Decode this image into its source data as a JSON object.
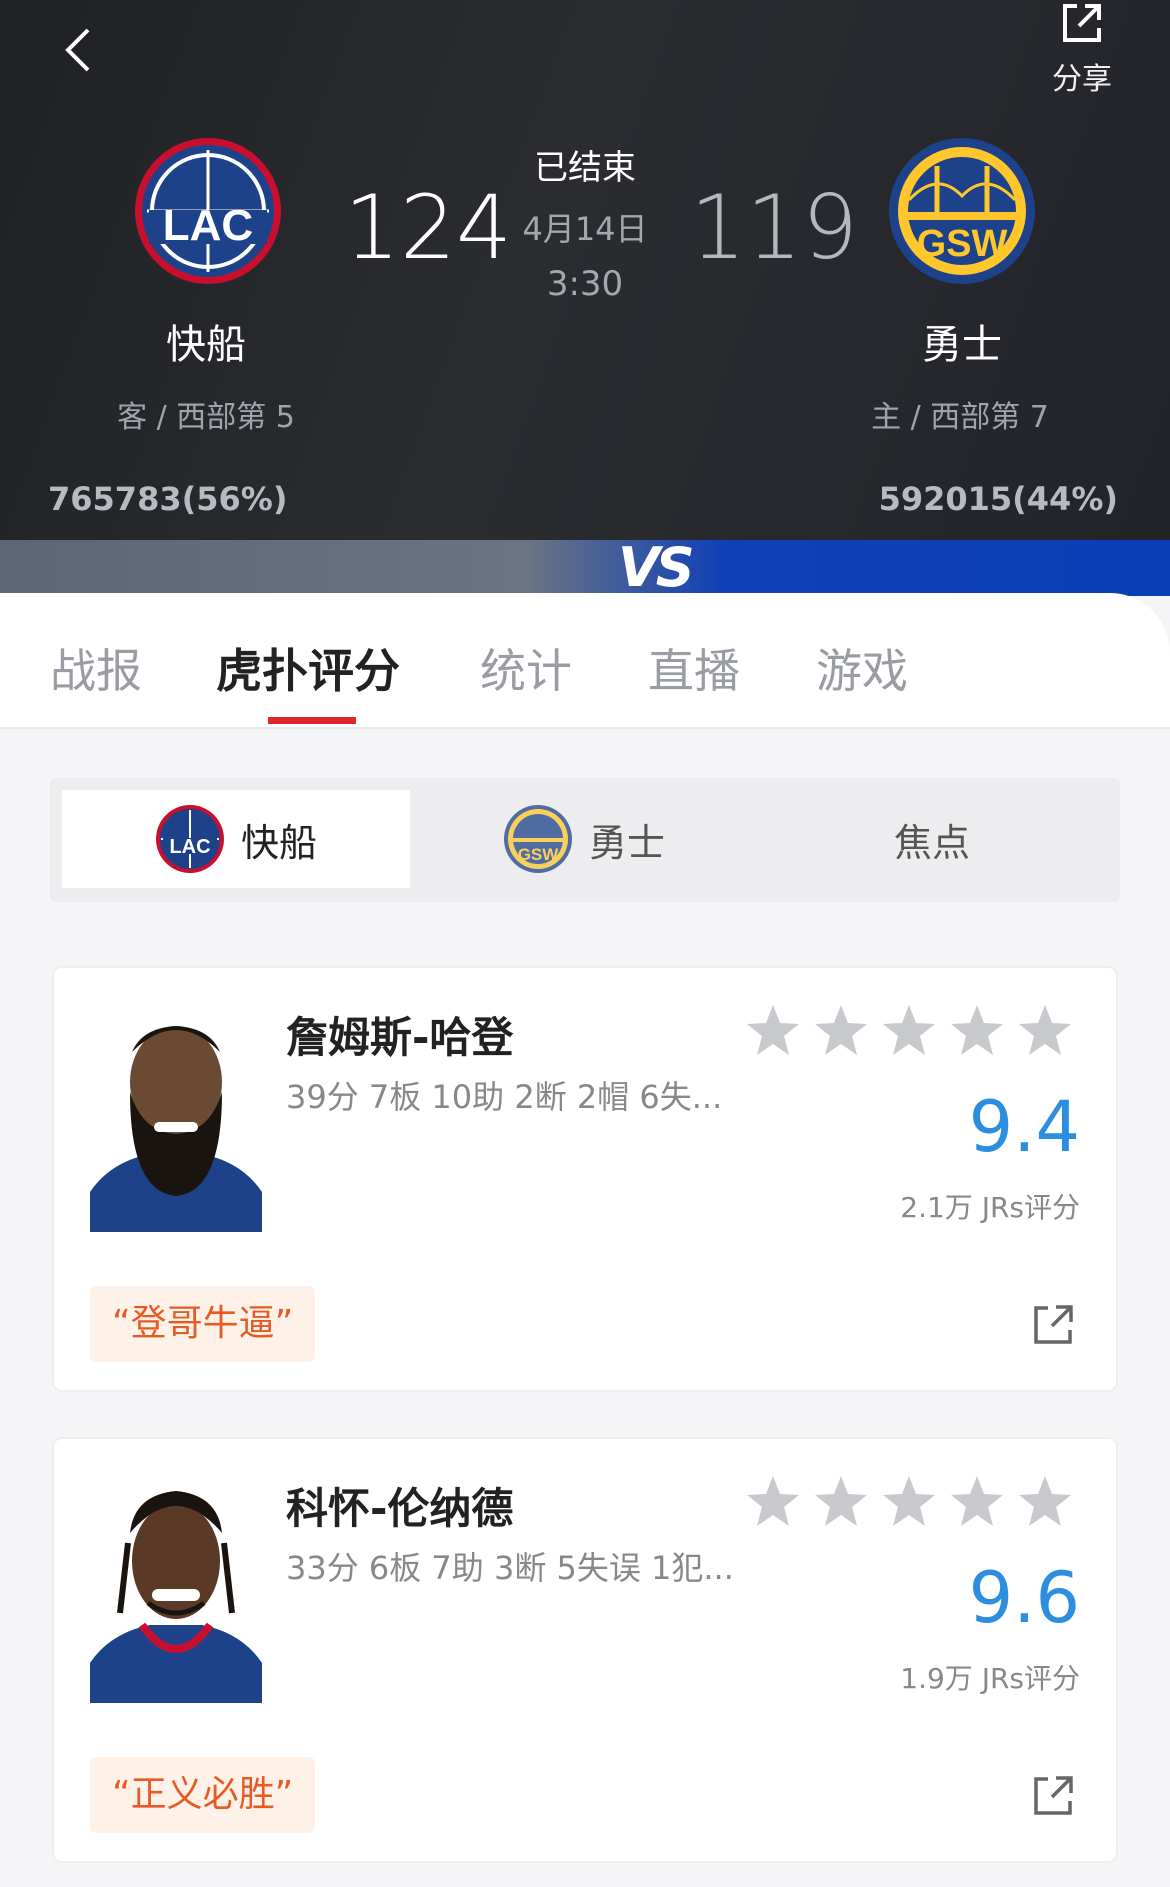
{
  "header": {
    "share_label": "分享",
    "status": "已结束",
    "date": "4月14日",
    "time": "3:30",
    "away": {
      "name": "快船",
      "rank": "客 / 西部第 5",
      "score": "124",
      "votes": "765783(56%)",
      "abbr": "LAC"
    },
    "home": {
      "name": "勇士",
      "rank": "主 / 西部第 7",
      "score": "119",
      "votes": "592015(44%)",
      "abbr": "GSW"
    }
  },
  "vs_label": "VS",
  "tabs": [
    {
      "label": "战报"
    },
    {
      "label": "虎扑评分",
      "active": true
    },
    {
      "label": "统计"
    },
    {
      "label": "直播"
    },
    {
      "label": "游戏"
    }
  ],
  "segments": [
    {
      "label": "快船",
      "active": true
    },
    {
      "label": "勇士"
    },
    {
      "label": "焦点"
    }
  ],
  "players": [
    {
      "name": "詹姆斯-哈登",
      "stats": "39分 7板 10助 2断 2帽 6失...",
      "rating": "9.4",
      "rating_count": "2.1万 JRs评分",
      "quote": "“登哥牛逼”",
      "stars": 5
    },
    {
      "name": "科怀-伦纳德",
      "stats": "33分 6板 7助 3断 5失误 1犯...",
      "rating": "9.6",
      "rating_count": "1.9万 JRs评分",
      "quote": "“正义必胜”",
      "stars": 5
    }
  ],
  "colors": {
    "accent_red": "#e1262d",
    "rating_blue": "#2d8ee0",
    "quote_orange": "#e65b25",
    "lac_blue": "#1d428a",
    "gsw_gold": "#ffc72c"
  },
  "icons": {
    "back": "chevron-left-icon",
    "share": "share-icon",
    "star": "star-icon"
  }
}
